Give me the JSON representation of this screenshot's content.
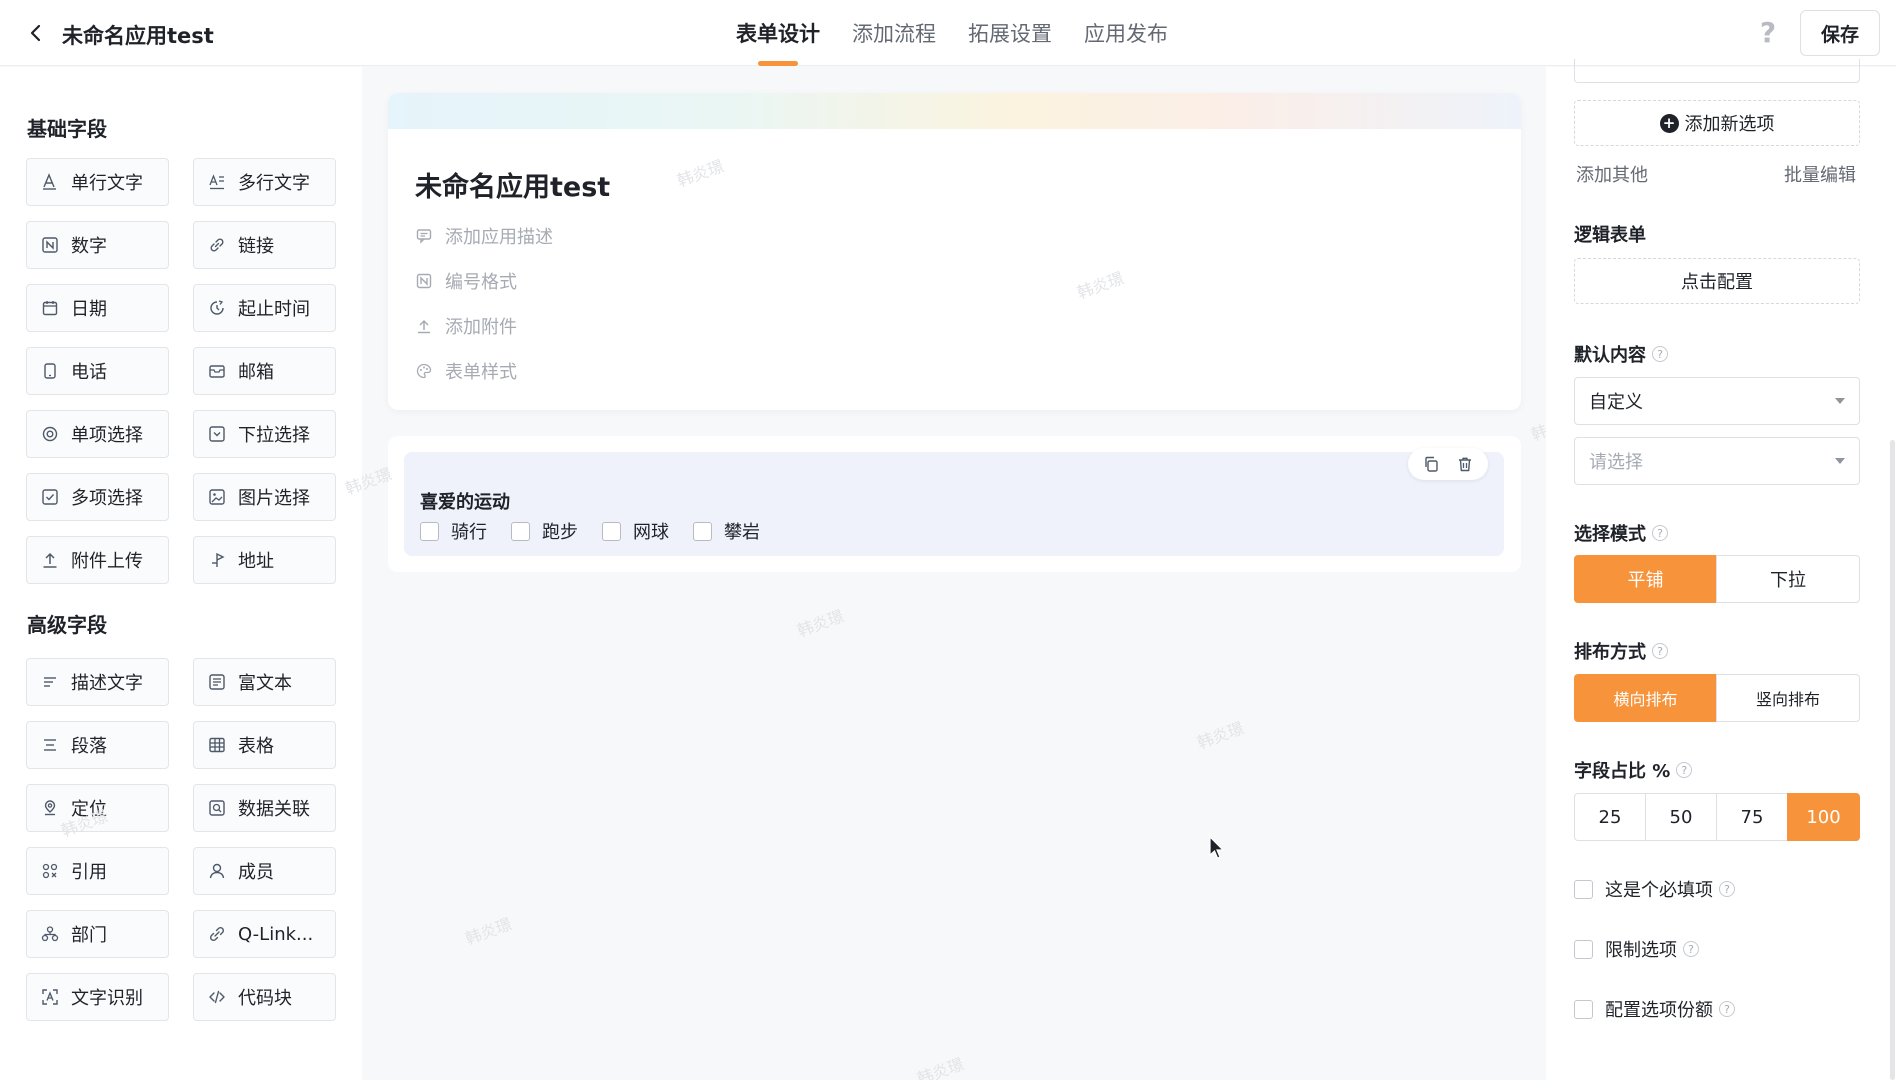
{
  "header": {
    "app_title": "未命名应用test",
    "tabs": [
      "表单设计",
      "添加流程",
      "拓展设置",
      "应用发布"
    ],
    "active_tab": 0,
    "help_label": "?",
    "save_label": "保存"
  },
  "left_panel": {
    "basic_title": "基础字段",
    "basic_fields": [
      {
        "label": "单行文字",
        "icon": "text-icon"
      },
      {
        "label": "多行文字",
        "icon": "multiline-text-icon"
      },
      {
        "label": "数字",
        "icon": "number-icon"
      },
      {
        "label": "链接",
        "icon": "link-icon"
      },
      {
        "label": "日期",
        "icon": "calendar-icon"
      },
      {
        "label": "起止时间",
        "icon": "clock-icon"
      },
      {
        "label": "电话",
        "icon": "phone-icon"
      },
      {
        "label": "邮箱",
        "icon": "mail-icon"
      },
      {
        "label": "单项选择",
        "icon": "radio-icon"
      },
      {
        "label": "下拉选择",
        "icon": "dropdown-icon"
      },
      {
        "label": "多项选择",
        "icon": "checkbox-icon"
      },
      {
        "label": "图片选择",
        "icon": "image-icon"
      },
      {
        "label": "附件上传",
        "icon": "upload-icon"
      },
      {
        "label": "地址",
        "icon": "location-pin-icon"
      }
    ],
    "advanced_title": "高级字段",
    "advanced_fields": [
      {
        "label": "描述文字",
        "icon": "description-icon"
      },
      {
        "label": "富文本",
        "icon": "rich-text-icon"
      },
      {
        "label": "段落",
        "icon": "paragraph-icon"
      },
      {
        "label": "表格",
        "icon": "table-icon"
      },
      {
        "label": "定位",
        "icon": "map-marker-icon"
      },
      {
        "label": "数据关联",
        "icon": "data-link-icon"
      },
      {
        "label": "引用",
        "icon": "reference-icon"
      },
      {
        "label": "成员",
        "icon": "user-icon"
      },
      {
        "label": "部门",
        "icon": "department-icon"
      },
      {
        "label": "Q-Link...",
        "icon": "qlink-icon"
      },
      {
        "label": "文字识别",
        "icon": "ocr-icon"
      },
      {
        "label": "代码块",
        "icon": "code-icon"
      }
    ]
  },
  "canvas": {
    "form_title": "未命名应用test",
    "meta_items": [
      {
        "label": "添加应用描述",
        "icon": "comment-icon"
      },
      {
        "label": "编号格式",
        "icon": "numbering-icon"
      },
      {
        "label": "添加附件",
        "icon": "upload-icon"
      },
      {
        "label": "表单样式",
        "icon": "palette-icon"
      }
    ],
    "question": {
      "label": "喜爱的运动",
      "options": [
        "骑行",
        "跑步",
        "网球",
        "攀岩"
      ]
    },
    "watermark": "韩炎璟"
  },
  "right_panel": {
    "add_option_label": "添加新选项",
    "add_other_label": "添加其他",
    "batch_edit_label": "批量编辑",
    "logic_form_title": "逻辑表单",
    "logic_config_label": "点击配置",
    "default_content_title": "默认内容",
    "default_content_value": "自定义",
    "default_select_placeholder": "请选择",
    "select_mode_title": "选择模式",
    "select_mode_options": [
      "平铺",
      "下拉"
    ],
    "select_mode_active": 0,
    "layout_title": "排布方式",
    "layout_options": [
      "横向排布",
      "竖向排布"
    ],
    "layout_active": 0,
    "width_ratio_title": "字段占比 %",
    "width_ratio_options": [
      "25",
      "50",
      "75",
      "100"
    ],
    "width_ratio_active": 3,
    "checkboxes": [
      {
        "label": "这是个必填项",
        "checked": false
      },
      {
        "label": "限制选项",
        "checked": false
      },
      {
        "label": "配置选项份额",
        "checked": false
      }
    ]
  },
  "colors": {
    "accent": "#f7933a",
    "question_bg": "#eff1fb"
  }
}
